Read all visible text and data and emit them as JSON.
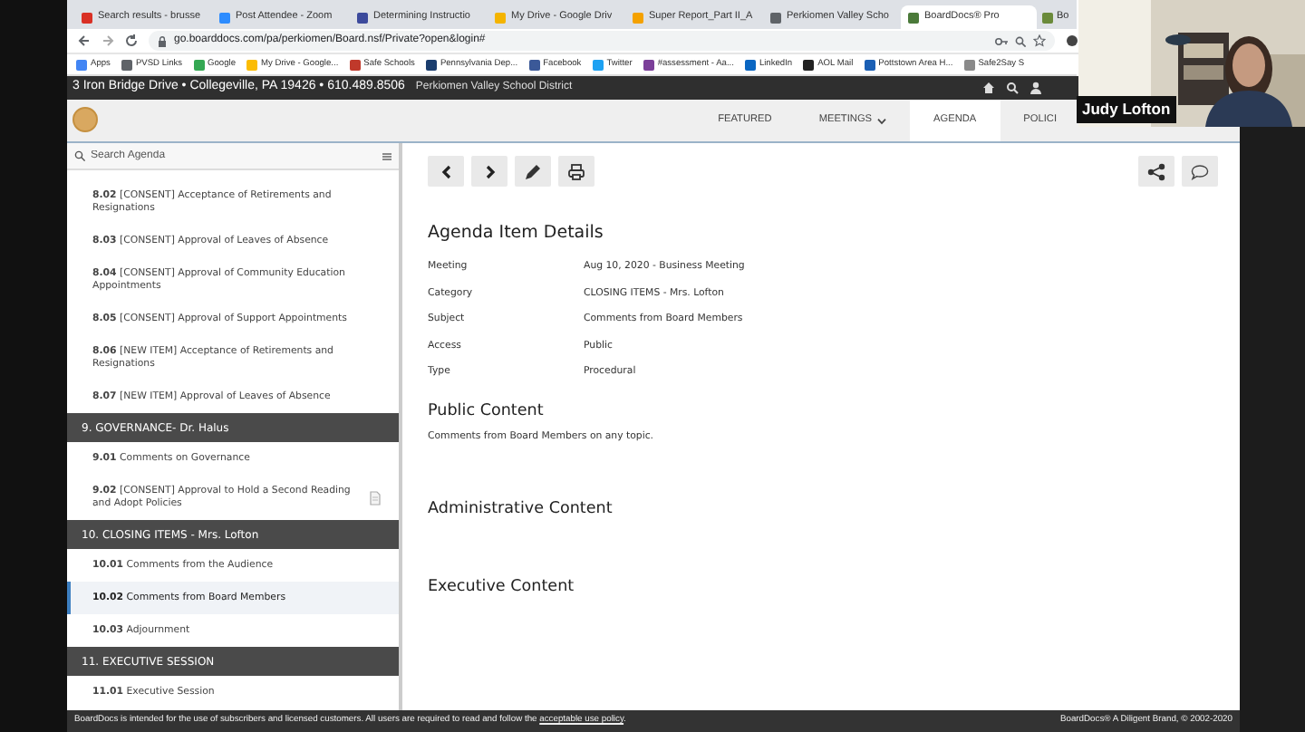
{
  "browser": {
    "tabs": [
      {
        "title": "Search results - brusse",
        "color": "#d93025",
        "selected": false
      },
      {
        "title": "Post Attendee - Zoom",
        "color": "#2d8cff",
        "selected": false
      },
      {
        "title": "Determining Instructio",
        "color": "#3c4a9c",
        "selected": false
      },
      {
        "title": "My Drive - Google Driv",
        "color": "#f4b400",
        "selected": false
      },
      {
        "title": "Super Report_Part II_A",
        "color": "#f4a100",
        "selected": false
      },
      {
        "title": "Perkiomen Valley Scho",
        "color": "#5f6368",
        "selected": false
      },
      {
        "title": "BoardDocs® Pro",
        "color": "#4b7a3a",
        "selected": true
      },
      {
        "title": "Bo",
        "color": "#6a8a3a",
        "selected": false
      }
    ],
    "url": "go.boarddocs.com/pa/perkiomen/Board.nsf/Private?open&login#",
    "bookmarks": [
      {
        "label": "Apps",
        "color": "#4285f4"
      },
      {
        "label": "PVSD Links",
        "color": "#5f6368"
      },
      {
        "label": "Google",
        "color": "#34a853"
      },
      {
        "label": "My Drive - Google...",
        "color": "#fbbc04"
      },
      {
        "label": "Safe Schools",
        "color": "#c0392b"
      },
      {
        "label": "Pennsylvania Dep...",
        "color": "#1a3d6e"
      },
      {
        "label": "Facebook",
        "color": "#3b5998"
      },
      {
        "label": "Twitter",
        "color": "#1da1f2"
      },
      {
        "label": "#assessment - Aa...",
        "color": "#7b3f99"
      },
      {
        "label": "LinkedIn",
        "color": "#0a66c2"
      },
      {
        "label": "AOL Mail",
        "color": "#222222"
      },
      {
        "label": "Pottstown Area H...",
        "color": "#1a5fb4"
      },
      {
        "label": "Safe2Say S",
        "color": "#8a8a8a"
      }
    ]
  },
  "site_header": {
    "address": "3 Iron Bridge Drive • Collegeville, PA 19426 • 610.489.8506",
    "district": "Perkiomen Valley School District"
  },
  "nav": [
    {
      "label": "FEATURED",
      "selected": false,
      "dropdown": false
    },
    {
      "label": "MEETINGS",
      "selected": false,
      "dropdown": true
    },
    {
      "label": "AGENDA",
      "selected": true,
      "dropdown": false
    },
    {
      "label": "POLICI",
      "selected": false,
      "dropdown": false
    }
  ],
  "sidebar": {
    "search_placeholder": "Search Agenda",
    "rows": [
      {
        "kind": "item",
        "number": "8.02",
        "text": "[CONSENT] Acceptance of Retirements and Resignations",
        "selected": false,
        "attachment": false
      },
      {
        "kind": "item",
        "number": "8.03",
        "text": "[CONSENT] Approval of Leaves of Absence",
        "selected": false,
        "attachment": false
      },
      {
        "kind": "item",
        "number": "8.04",
        "text": "[CONSENT] Approval of Community Education Appointments",
        "selected": false,
        "attachment": false
      },
      {
        "kind": "item",
        "number": "8.05",
        "text": "[CONSENT] Approval of Support Appointments",
        "selected": false,
        "attachment": false
      },
      {
        "kind": "item",
        "number": "8.06",
        "text": "[NEW ITEM] Acceptance of Retirements and Resignations",
        "selected": false,
        "attachment": false
      },
      {
        "kind": "item",
        "number": "8.07",
        "text": "[NEW ITEM] Approval of Leaves of Absence",
        "selected": false,
        "attachment": false
      },
      {
        "kind": "section",
        "text": "9. GOVERNANCE- Dr. Halus"
      },
      {
        "kind": "item",
        "number": "9.01",
        "text": "Comments on Governance",
        "selected": false,
        "attachment": false
      },
      {
        "kind": "item",
        "number": "9.02",
        "text": "[CONSENT] Approval to Hold a Second Reading and Adopt Policies",
        "selected": false,
        "attachment": true
      },
      {
        "kind": "section",
        "text": "10. CLOSING ITEMS - Mrs. Lofton"
      },
      {
        "kind": "item",
        "number": "10.01",
        "text": "Comments from the Audience",
        "selected": false,
        "attachment": false
      },
      {
        "kind": "item",
        "number": "10.02",
        "text": "Comments from Board Members",
        "selected": true,
        "attachment": false
      },
      {
        "kind": "item",
        "number": "10.03",
        "text": "Adjournment",
        "selected": false,
        "attachment": false
      },
      {
        "kind": "section",
        "text": "11. EXECUTIVE SESSION"
      },
      {
        "kind": "item",
        "number": "11.01",
        "text": "Executive Session",
        "selected": false,
        "attachment": false
      }
    ]
  },
  "item": {
    "heading": "Agenda Item Details",
    "fields": [
      {
        "label": "Meeting",
        "value": "Aug 10, 2020 - Business Meeting"
      },
      {
        "label": "Category",
        "value": "CLOSING ITEMS - Mrs. Lofton"
      },
      {
        "label": "Subject",
        "value": "Comments from Board Members"
      },
      {
        "label": "Access",
        "value": "Public"
      },
      {
        "label": "Type",
        "value": "Procedural"
      }
    ],
    "sections": [
      {
        "heading": "Public Content",
        "body": "Comments from Board Members on any topic."
      },
      {
        "heading": "Administrative Content"
      },
      {
        "heading": "Executive Content"
      }
    ]
  },
  "footer": {
    "notice": "BoardDocs is intended for the use of subscribers and licensed customers. All users are required to read and follow the",
    "notice_link": "acceptable use policy",
    "notice_end": ".",
    "copyright": "BoardDocs® A Diligent Brand, © 2002-2020"
  },
  "webcam": {
    "kind": "picture",
    "name_label": "Judy Lofton"
  }
}
